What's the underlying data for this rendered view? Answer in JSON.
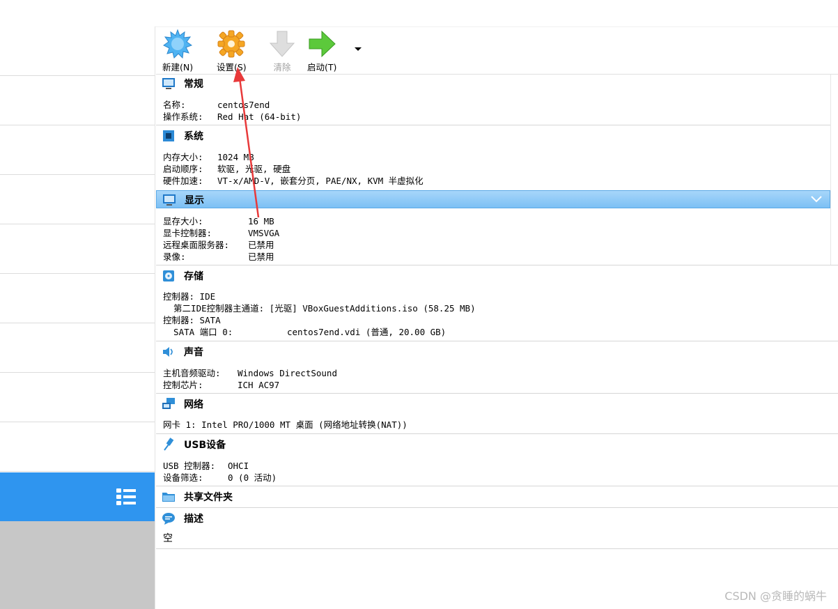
{
  "toolbar": {
    "new_label": "新建(N)",
    "settings_label": "设置(S)",
    "clear_label": "清除",
    "start_label": "启动(T)"
  },
  "general": {
    "title": "常规",
    "name_key": "名称:",
    "name_val": "centos7end",
    "os_key": "操作系统:",
    "os_val": "Red Hat (64-bit)"
  },
  "system": {
    "title": "系统",
    "mem_key": "内存大小:",
    "mem_val": "1024 MB",
    "boot_key": "启动顺序:",
    "boot_val": "软驱, 光驱, 硬盘",
    "accel_key": "硬件加速:",
    "accel_val": "VT-x/AMD-V, 嵌套分页, PAE/NX, KVM 半虚拟化"
  },
  "display": {
    "title": "显示",
    "vram_key": "显存大小:",
    "vram_val": "16 MB",
    "ctrl_key": "显卡控制器:",
    "ctrl_val": "VMSVGA",
    "rdp_key": "远程桌面服务器:",
    "rdp_val": "已禁用",
    "rec_key": "录像:",
    "rec_val": "已禁用"
  },
  "storage": {
    "title": "存储",
    "l1": "控制器: IDE",
    "l2": "  第二IDE控制器主通道: [光驱] VBoxGuestAdditions.iso (58.25 MB)",
    "l3": "控制器: SATA",
    "l4_key": "  SATA 端口 0:",
    "l4_val": "centos7end.vdi (普通, 20.00 GB)"
  },
  "audio": {
    "title": "声音",
    "driver_key": "主机音频驱动:",
    "driver_val": "Windows DirectSound",
    "chip_key": "控制芯片:",
    "chip_val": "ICH AC97"
  },
  "network": {
    "title": "网络",
    "l1": "网卡 1: Intel PRO/1000 MT 桌面 (网络地址转换(NAT))"
  },
  "usb": {
    "title": "USB设备",
    "ctrl_key": "USB 控制器:",
    "ctrl_val": "OHCI",
    "filter_key": "设备筛选:",
    "filter_val": "0 (0 活动)"
  },
  "shared": {
    "title": "共享文件夹"
  },
  "desc": {
    "title": "描述",
    "l1": "空"
  },
  "watermark": "CSDN @贪睡的蜗牛",
  "colors": {
    "selection": "#2f95ef",
    "active_header": "#8ac8f6",
    "annotation_arrow": "#e8393a"
  },
  "icons": [
    "new-icon",
    "settings-gear-icon",
    "discard-arrow-icon",
    "start-arrow-icon",
    "monitor-icon",
    "chip-icon",
    "storage-disk-icon",
    "speaker-icon",
    "network-icon",
    "usb-icon",
    "folder-icon",
    "speech-bubble-icon",
    "list-view-icon",
    "chevron-down-icon"
  ]
}
